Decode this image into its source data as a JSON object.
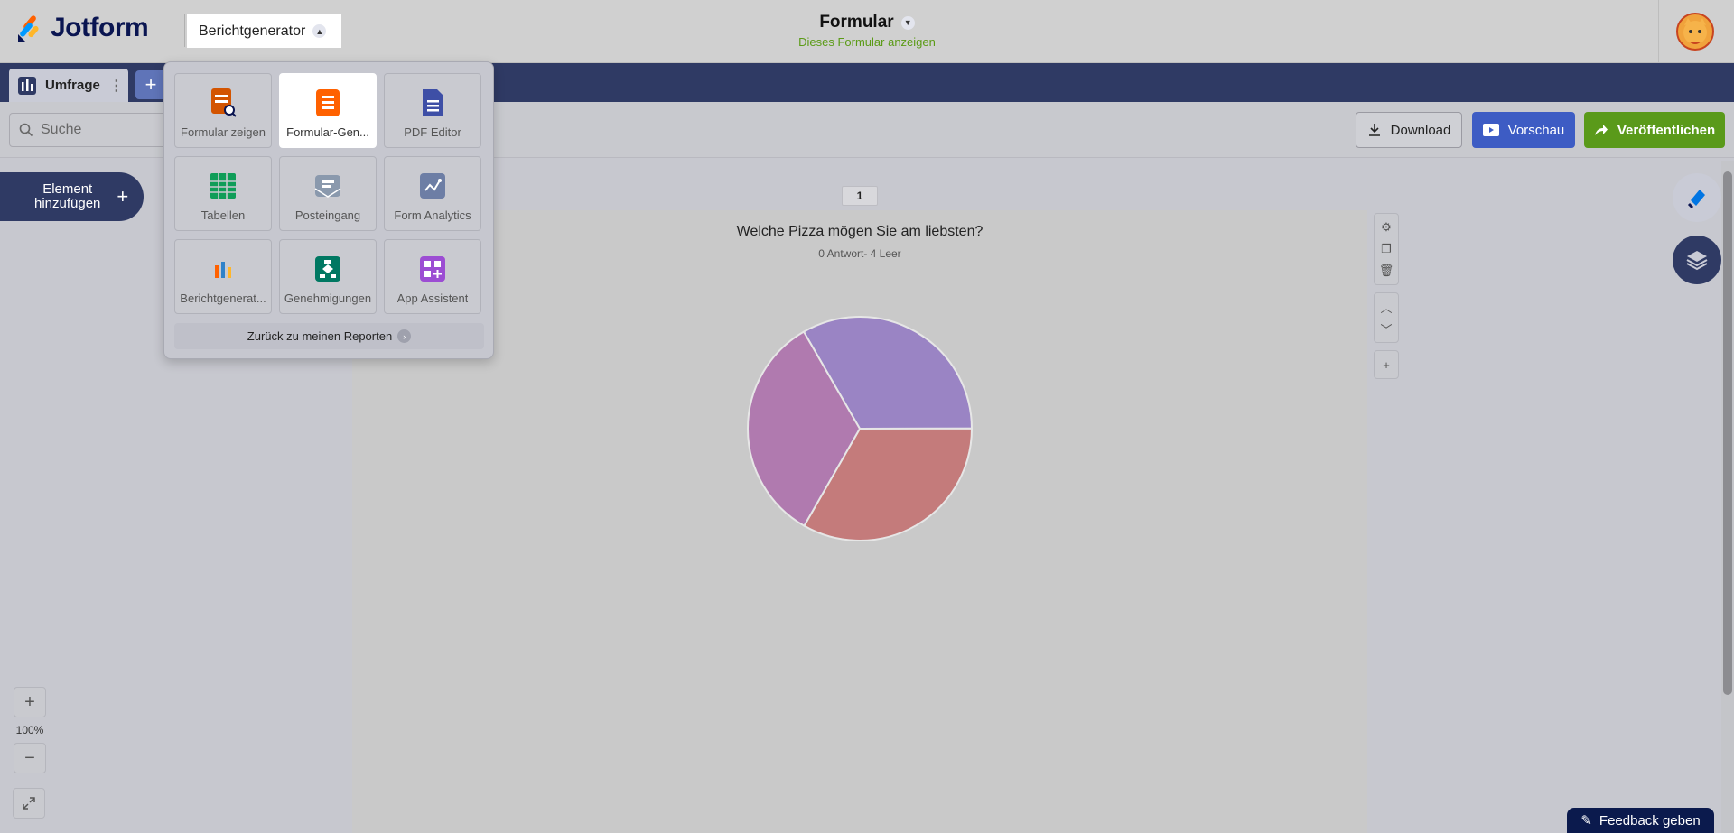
{
  "header": {
    "logo_text": "Jotform",
    "app_switch_label": "Berichtgenerator",
    "form_title": "Formular",
    "form_subtitle": "Dieses Formular anzeigen"
  },
  "tabs": {
    "active_label": "Umfrage",
    "add_symbol": "+"
  },
  "toolbar": {
    "search_placeholder": "Suche",
    "download_label": "Download",
    "preview_label": "Vorschau",
    "publish_label": "Veröffentlichen"
  },
  "left": {
    "add_element_label_line1": "Element",
    "add_element_label_line2": "hinzufügen",
    "add_symbol": "+",
    "zoom_in": "+",
    "zoom_level": "100%",
    "zoom_out": "−"
  },
  "report": {
    "page_number": "1",
    "question": "Welche Pizza mögen Sie am liebsten?",
    "answers": "0 Antwort- 4 Leer"
  },
  "chart_data": {
    "type": "pie",
    "title": "Welche Pizza mögen Sie am liebsten?",
    "subtitle": "0 Antwort- 4 Leer",
    "values": [
      33.3,
      33.3,
      33.4
    ],
    "colors": [
      "#9a84c4",
      "#c47b7b",
      "#b07aaf"
    ]
  },
  "app_menu": {
    "items": [
      {
        "label": "Formular zeigen",
        "icon": "form-search-icon",
        "color": "#d35400"
      },
      {
        "label": "Formular-Gen...",
        "icon": "form-builder-icon",
        "color": "#ff6100",
        "active": true
      },
      {
        "label": "PDF Editor",
        "icon": "pdf-editor-icon",
        "color": "#3e4fa6"
      },
      {
        "label": "Tabellen",
        "icon": "tables-icon",
        "color": "#0f9d58"
      },
      {
        "label": "Posteingang",
        "icon": "inbox-icon",
        "color": "#8a99ad"
      },
      {
        "label": "Form Analytics",
        "icon": "analytics-icon",
        "color": "#6d7ea5"
      },
      {
        "label": "Berichtgenerat...",
        "icon": "report-builder-icon",
        "color": "#2f82c9"
      },
      {
        "label": "Genehmigungen",
        "icon": "approvals-icon",
        "color": "#007862"
      },
      {
        "label": "App Assistent",
        "icon": "app-builder-icon",
        "color": "#9c4dd3"
      }
    ],
    "back_label": "Zurück zu meinen Reporten"
  },
  "feedback_label": "Feedback geben",
  "colors": {
    "navy": "#2f3a64",
    "preview_blue": "#3d5cc4",
    "publish_green": "#5a9a1a",
    "subtitle_green": "#5b9b16"
  }
}
